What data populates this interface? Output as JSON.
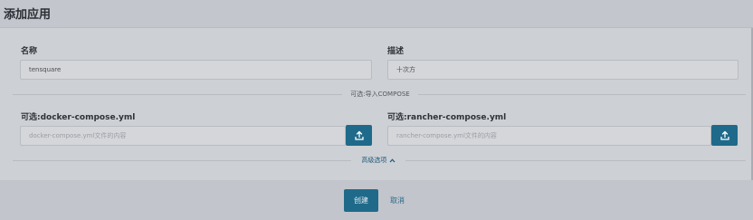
{
  "header": {
    "title": "添加应用"
  },
  "form": {
    "name_label": "名称",
    "name_value": "tensquare",
    "desc_label": "描述",
    "desc_value": "十次方",
    "import_divider": "可选:导入COMPOSE",
    "docker_label": "可选:docker-compose.yml",
    "docker_placeholder": "docker-compose.yml文件的内容",
    "rancher_label": "可选:rancher-compose.yml",
    "rancher_placeholder": "rancher-compose.yml文件的内容",
    "advanced_label": "高级选项"
  },
  "footer": {
    "create_label": "创建",
    "cancel_label": "取消"
  },
  "colors": {
    "accent": "#1f6a8a",
    "background": "#c2c5cb",
    "panel": "#cdd0d5"
  }
}
